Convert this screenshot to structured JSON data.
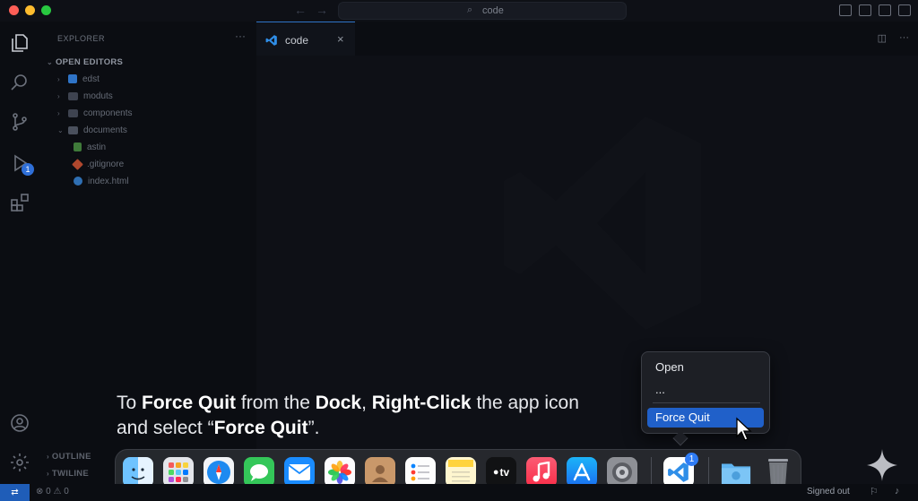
{
  "window": {
    "search_text": "code"
  },
  "sidebar": {
    "title": "EXPLORER",
    "more": "···",
    "open_editors_heading": "OPEN EDITORS",
    "tree": [
      {
        "label": "edst"
      },
      {
        "label": "moduts"
      },
      {
        "label": "components"
      },
      {
        "label": "documents"
      },
      {
        "label": "astin"
      },
      {
        "label": ".gitignore"
      },
      {
        "label": "index.html"
      }
    ],
    "outline_heading": "OUTLINE",
    "timeline_heading": "TWILINE"
  },
  "activity_bar": {
    "run_badge": "1"
  },
  "editor": {
    "tab_label": "code",
    "tab_close": "×"
  },
  "caption": {
    "p1": "To ",
    "b1": "Force Quit",
    "p2": " from the ",
    "b2": "Dock",
    "p3": ", ",
    "b3": "Right-Click",
    "p4": " the app icon and select “",
    "b4": "Force Quit",
    "p5": "”."
  },
  "context_menu": {
    "items": [
      {
        "label": "Open"
      },
      {
        "label": "..."
      },
      {
        "label": "Force Quit",
        "highlighted": true
      }
    ]
  },
  "dock": {
    "apps": [
      {
        "name": "Finder",
        "running": true
      },
      {
        "name": "Launchpad"
      },
      {
        "name": "Safari"
      },
      {
        "name": "Messages"
      },
      {
        "name": "Mail"
      },
      {
        "name": "Photos"
      },
      {
        "name": "Contacts"
      },
      {
        "name": "Reminders"
      },
      {
        "name": "Notes"
      },
      {
        "name": "TV",
        "label": "tv"
      },
      {
        "name": "Music"
      },
      {
        "name": "App Store"
      },
      {
        "name": "System Settings"
      },
      {
        "name": "Visual Studio Code",
        "running": true,
        "badge": "1"
      },
      {
        "name": "Downloads"
      },
      {
        "name": "Trash"
      }
    ]
  },
  "status_bar": {
    "remote": "⇄",
    "errors": "0",
    "warnings": "0",
    "signed_out": "Signed out"
  },
  "colors": {
    "accent": "#2060c9",
    "status_remote": "#1f5db8"
  }
}
